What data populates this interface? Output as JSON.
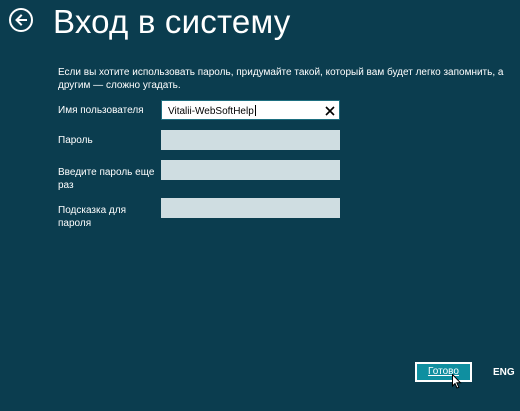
{
  "header": {
    "title": "Вход в систему",
    "back_icon": "arrow-left-circle-icon"
  },
  "description": "Если вы хотите использовать пароль, придумайте такой, который вам будет легко запомнить, а другим — сложно угадать.",
  "form": {
    "username_label": "Имя пользователя",
    "username_value": "Vitalii-WebSoftHelp",
    "password_label": "Пароль",
    "password_value": "",
    "confirm_label": "Введите пароль еще раз",
    "confirm_value": "",
    "hint_label": "Подсказка для пароля",
    "hint_value": "",
    "clear_icon": "close-icon"
  },
  "footer": {
    "done_label": "Готово",
    "language": "ENG"
  },
  "colors": {
    "background": "#0b3d4f",
    "button": "#0f8fa0",
    "field_inactive": "#cfdde1"
  }
}
